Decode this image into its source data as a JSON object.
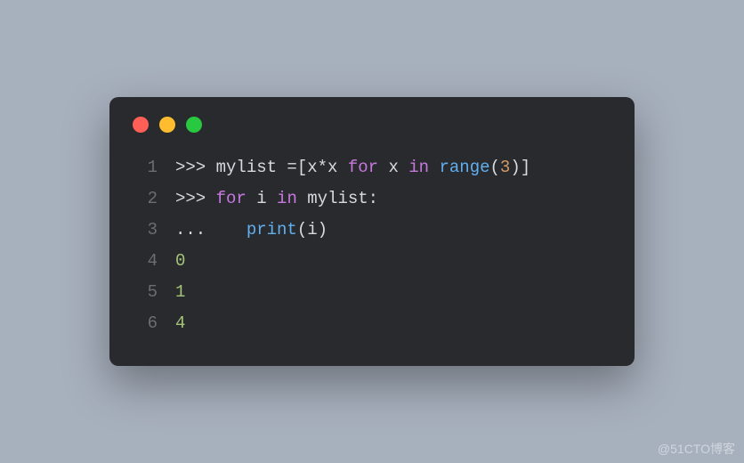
{
  "window": {
    "dots": [
      "red",
      "yellow",
      "green"
    ]
  },
  "code": {
    "lines": [
      {
        "n": "1",
        "tokens": [
          {
            "c": "tok-plain",
            "t": ">>> mylist =[x*x "
          },
          {
            "c": "tok-keyword",
            "t": "for"
          },
          {
            "c": "tok-plain",
            "t": " x "
          },
          {
            "c": "tok-keyword",
            "t": "in"
          },
          {
            "c": "tok-plain",
            "t": " "
          },
          {
            "c": "tok-func",
            "t": "range"
          },
          {
            "c": "tok-plain",
            "t": "("
          },
          {
            "c": "tok-num",
            "t": "3"
          },
          {
            "c": "tok-plain",
            "t": ")]"
          }
        ]
      },
      {
        "n": "2",
        "tokens": [
          {
            "c": "tok-plain",
            "t": ">>> "
          },
          {
            "c": "tok-keyword",
            "t": "for"
          },
          {
            "c": "tok-plain",
            "t": " i "
          },
          {
            "c": "tok-keyword",
            "t": "in"
          },
          {
            "c": "tok-plain",
            "t": " mylist:"
          }
        ]
      },
      {
        "n": "3",
        "tokens": [
          {
            "c": "tok-plain",
            "t": "...    "
          },
          {
            "c": "tok-func",
            "t": "print"
          },
          {
            "c": "tok-plain",
            "t": "(i)"
          }
        ]
      },
      {
        "n": "4",
        "tokens": [
          {
            "c": "tok-out",
            "t": "0"
          }
        ]
      },
      {
        "n": "5",
        "tokens": [
          {
            "c": "tok-out",
            "t": "1"
          }
        ]
      },
      {
        "n": "6",
        "tokens": [
          {
            "c": "tok-out",
            "t": "4"
          }
        ]
      }
    ]
  },
  "watermark": "@51CTO博客"
}
